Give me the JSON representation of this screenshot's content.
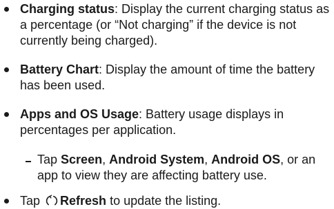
{
  "items": [
    {
      "term": "Charging status",
      "desc": ": Display the current charging status as a percentage (or “Not charging” if the device is not currently being charged)."
    },
    {
      "term": "Battery Chart",
      "desc": ": Display the amount of time the battery has been used."
    },
    {
      "term": "Apps and OS Usage",
      "desc": ": Battery usage displays in percentages per application."
    }
  ],
  "subitem": {
    "t1": "Tap ",
    "b1": "Screen",
    "t2": ", ",
    "b2": "Android System",
    "t3": ", ",
    "b3": "Android OS",
    "t4": ", or an app to view they are affecting battery use."
  },
  "last": {
    "t1": "Tap ",
    "icon": "refresh-icon",
    "b1": "Refresh",
    "t2": " to update the listing."
  }
}
